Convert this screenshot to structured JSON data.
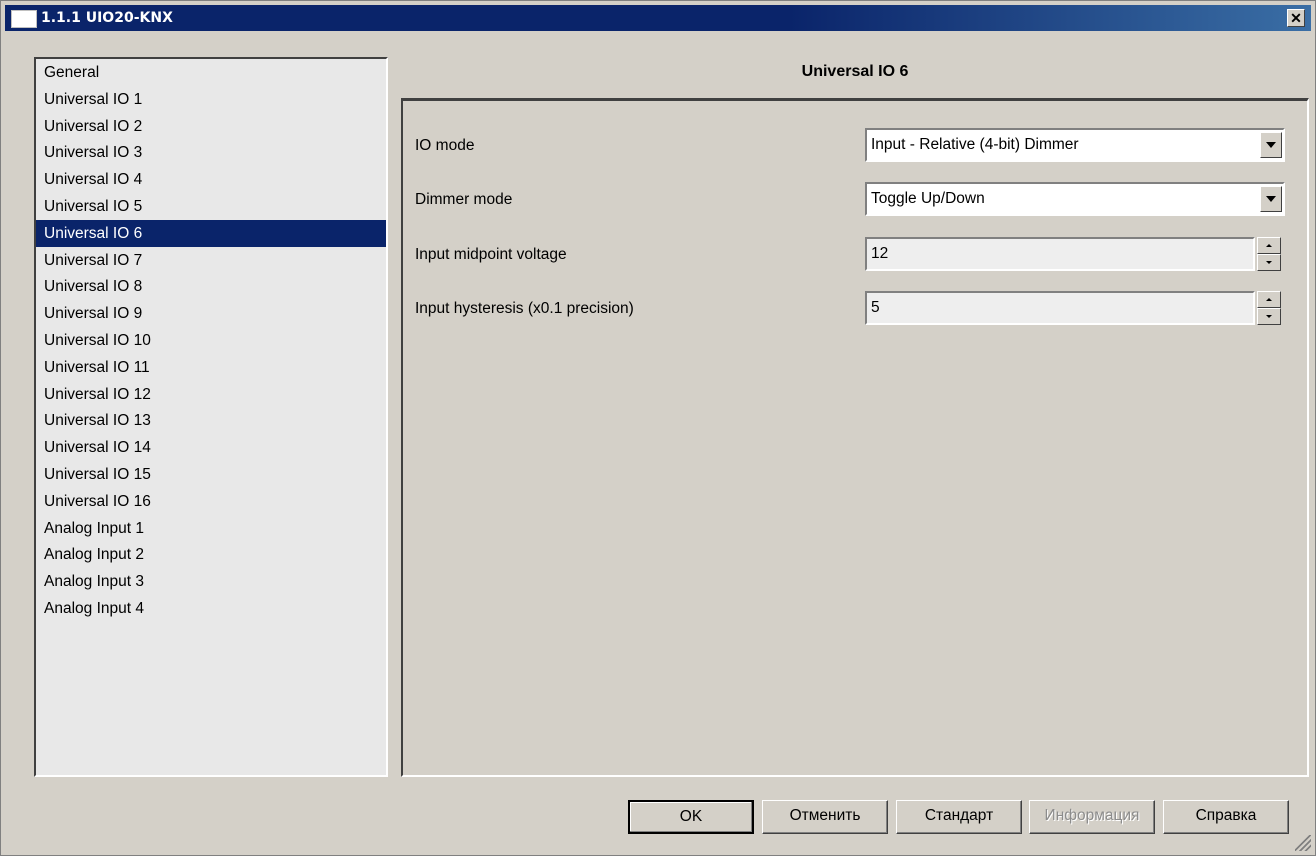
{
  "window": {
    "title": "1.1.1 UIO20-KNX",
    "close_glyph": "✕"
  },
  "nav": {
    "items": [
      "General",
      "Universal IO 1",
      "Universal IO 2",
      "Universal IO 3",
      "Universal IO 4",
      "Universal IO 5",
      "Universal IO 6",
      "Universal IO 7",
      "Universal IO 8",
      "Universal IO 9",
      "Universal IO 10",
      "Universal IO 11",
      "Universal IO 12",
      "Universal IO 13",
      "Universal IO 14",
      "Universal IO 15",
      "Universal IO 16",
      "Analog Input 1",
      "Analog Input 2",
      "Analog Input 3",
      "Analog Input 4"
    ],
    "selected": "Universal IO 6"
  },
  "panel": {
    "title": "Universal IO 6",
    "io_mode": {
      "label": "IO mode",
      "value": "Input - Relative (4-bit) Dimmer"
    },
    "dimmer_mode": {
      "label": "Dimmer mode",
      "value": "Toggle Up/Down"
    },
    "midpoint_voltage": {
      "label": "Input midpoint voltage",
      "value": "12"
    },
    "hysteresis": {
      "label": "Input hysteresis (x0.1 precision)",
      "value": "5"
    }
  },
  "buttons": {
    "ok": "OK",
    "cancel": "Отменить",
    "default": "Стандарт",
    "info": "Информация",
    "help": "Справка"
  },
  "colors": {
    "titlebar": "#0a246a",
    "selection": "#0a246a",
    "face": "#d4d0c8"
  }
}
